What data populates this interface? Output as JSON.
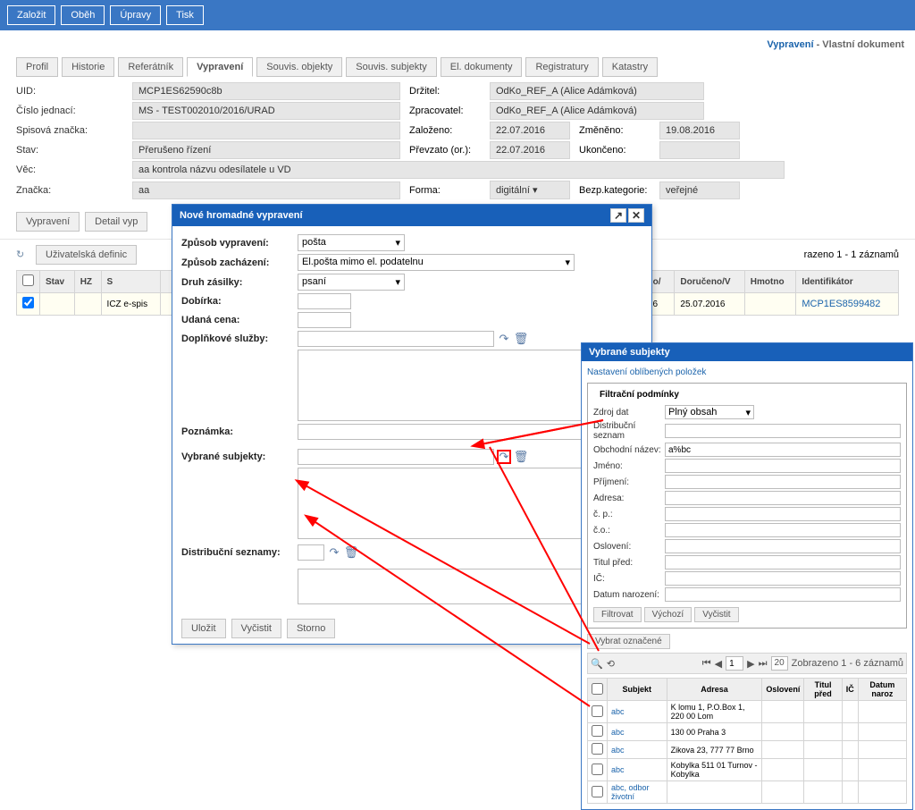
{
  "topbar": {
    "zalozit": "Založit",
    "obeh": "Oběh",
    "upravy": "Úpravy",
    "tisk": "Tisk"
  },
  "header": {
    "blue": "Vypravení",
    "gray": " - Vlastní dokument"
  },
  "tabs": {
    "profil": "Profil",
    "historie": "Historie",
    "referatnik": "Referátník",
    "vypraveni": "Vypravení",
    "souvobj": "Souvis. objekty",
    "souvsubj": "Souvis. subjekty",
    "eldok": "El. dokumenty",
    "reg": "Registratury",
    "kat": "Katastry"
  },
  "form": {
    "uid_l": "UID:",
    "uid": "MCP1ES62590c8b",
    "cj_l": "Číslo jednací:",
    "cj": "MS - TEST002010/2016/URAD",
    "sz_l": "Spisová značka:",
    "sz": "",
    "stav_l": "Stav:",
    "stav": "Přerušeno řízení",
    "vec_l": "Věc:",
    "vec": "aa kontrola názvu odesílatele u VD",
    "zn_l": "Značka:",
    "zn": "aa",
    "drz_l": "Držitel:",
    "drz": "OdKo_REF_A (Alice Adámková)",
    "zpr_l": "Zpracovatel:",
    "zpr": "OdKo_REF_A (Alice Adámková)",
    "zal_l": "Založeno:",
    "zal": "22.07.2016",
    "zmn_l": "Změněno:",
    "zmn": "19.08.2016",
    "prev_l": "Převzato (or.):",
    "prev": "22.07.2016",
    "uk_l": "Ukončeno:",
    "uk": "",
    "forma_l": "Forma:",
    "forma": "digitální",
    "bk_l": "Bezp.kategorie:",
    "bk": "veřejné"
  },
  "midbtns": {
    "vypraveni": "Vypravení",
    "detail": "Detail vyp"
  },
  "gridbar": {
    "udef": "Uživatelská definic",
    "razeno": "razeno 1 - 1 záznamů"
  },
  "grid": {
    "h_stav": "Stav",
    "h_hz": "HZ",
    "h_s": "S",
    "h_vyp": "Vypraveno/",
    "h_dor": "Doručeno/V",
    "h_hm": "Hmotno",
    "h_id": "Identifikátor",
    "r1_s": "ICZ e-spis",
    "r1_vyp": "22.07.2016",
    "r1_dor": "25.07.2016",
    "r1_id": "MCP1ES8599482"
  },
  "modal": {
    "title": "Nové hromadné vypravení",
    "zpvyp_l": "Způsob vypravení:",
    "zpvyp": "pošta",
    "zpzach_l": "Způsob zacházení:",
    "zpzach": "El.pošta mimo el. podatelnu",
    "druh_l": "Druh zásilky:",
    "druh": "psaní",
    "dob_l": "Dobírka:",
    "cena_l": "Udaná cena:",
    "dop_l": "Doplňkové služby:",
    "pozn_l": "Poznámka:",
    "subj_l": "Vybrané subjekty:",
    "dist_l": "Distribuční seznamy:",
    "ulozit": "Uložit",
    "vycistit": "Vyčistit",
    "storno": "Storno"
  },
  "picker": {
    "title": "Vybrané subjekty",
    "favlink": "Nastavení oblíbených položek",
    "legend": "Filtrační podmínky",
    "zdr_l": "Zdroj dat",
    "zdr": "Plný obsah",
    "dist_l": "Distribuční seznam",
    "obn_l": "Obchodní název:",
    "obn": "a%bc",
    "jm_l": "Jméno:",
    "pr_l": "Příjmení:",
    "adr_l": "Adresa:",
    "cp_l": "č. p.:",
    "co_l": "č.o.:",
    "osl_l": "Oslovení:",
    "tit_l": "Titul před:",
    "ic_l": "IČ:",
    "dn_l": "Datum narození:",
    "filtr": "Filtrovat",
    "vych": "Výchozí",
    "vyc": "Vyčistit",
    "vybr": "Vybrat označené",
    "page": "1",
    "psize": "20",
    "pinfo": "Zobrazeno 1 - 6 záznamů",
    "th_sub": "Subjekt",
    "th_adr": "Adresa",
    "th_osl": "Oslovení",
    "th_tit": "Titul před",
    "th_ic": "IČ",
    "th_dn": "Datum naroz",
    "r1s": "abc",
    "r1a": "K lomu 1, P.O.Box 1, 220 00 Lom",
    "r2s": "abc",
    "r2a": "130 00 Praha 3",
    "r3s": "abc",
    "r3a": "Zikova 23, 777 77 Brno",
    "r4s": "abc",
    "r4a": "Kobylka 511 01 Turnov - Kobylka",
    "r5s": "abc, odbor životní"
  }
}
